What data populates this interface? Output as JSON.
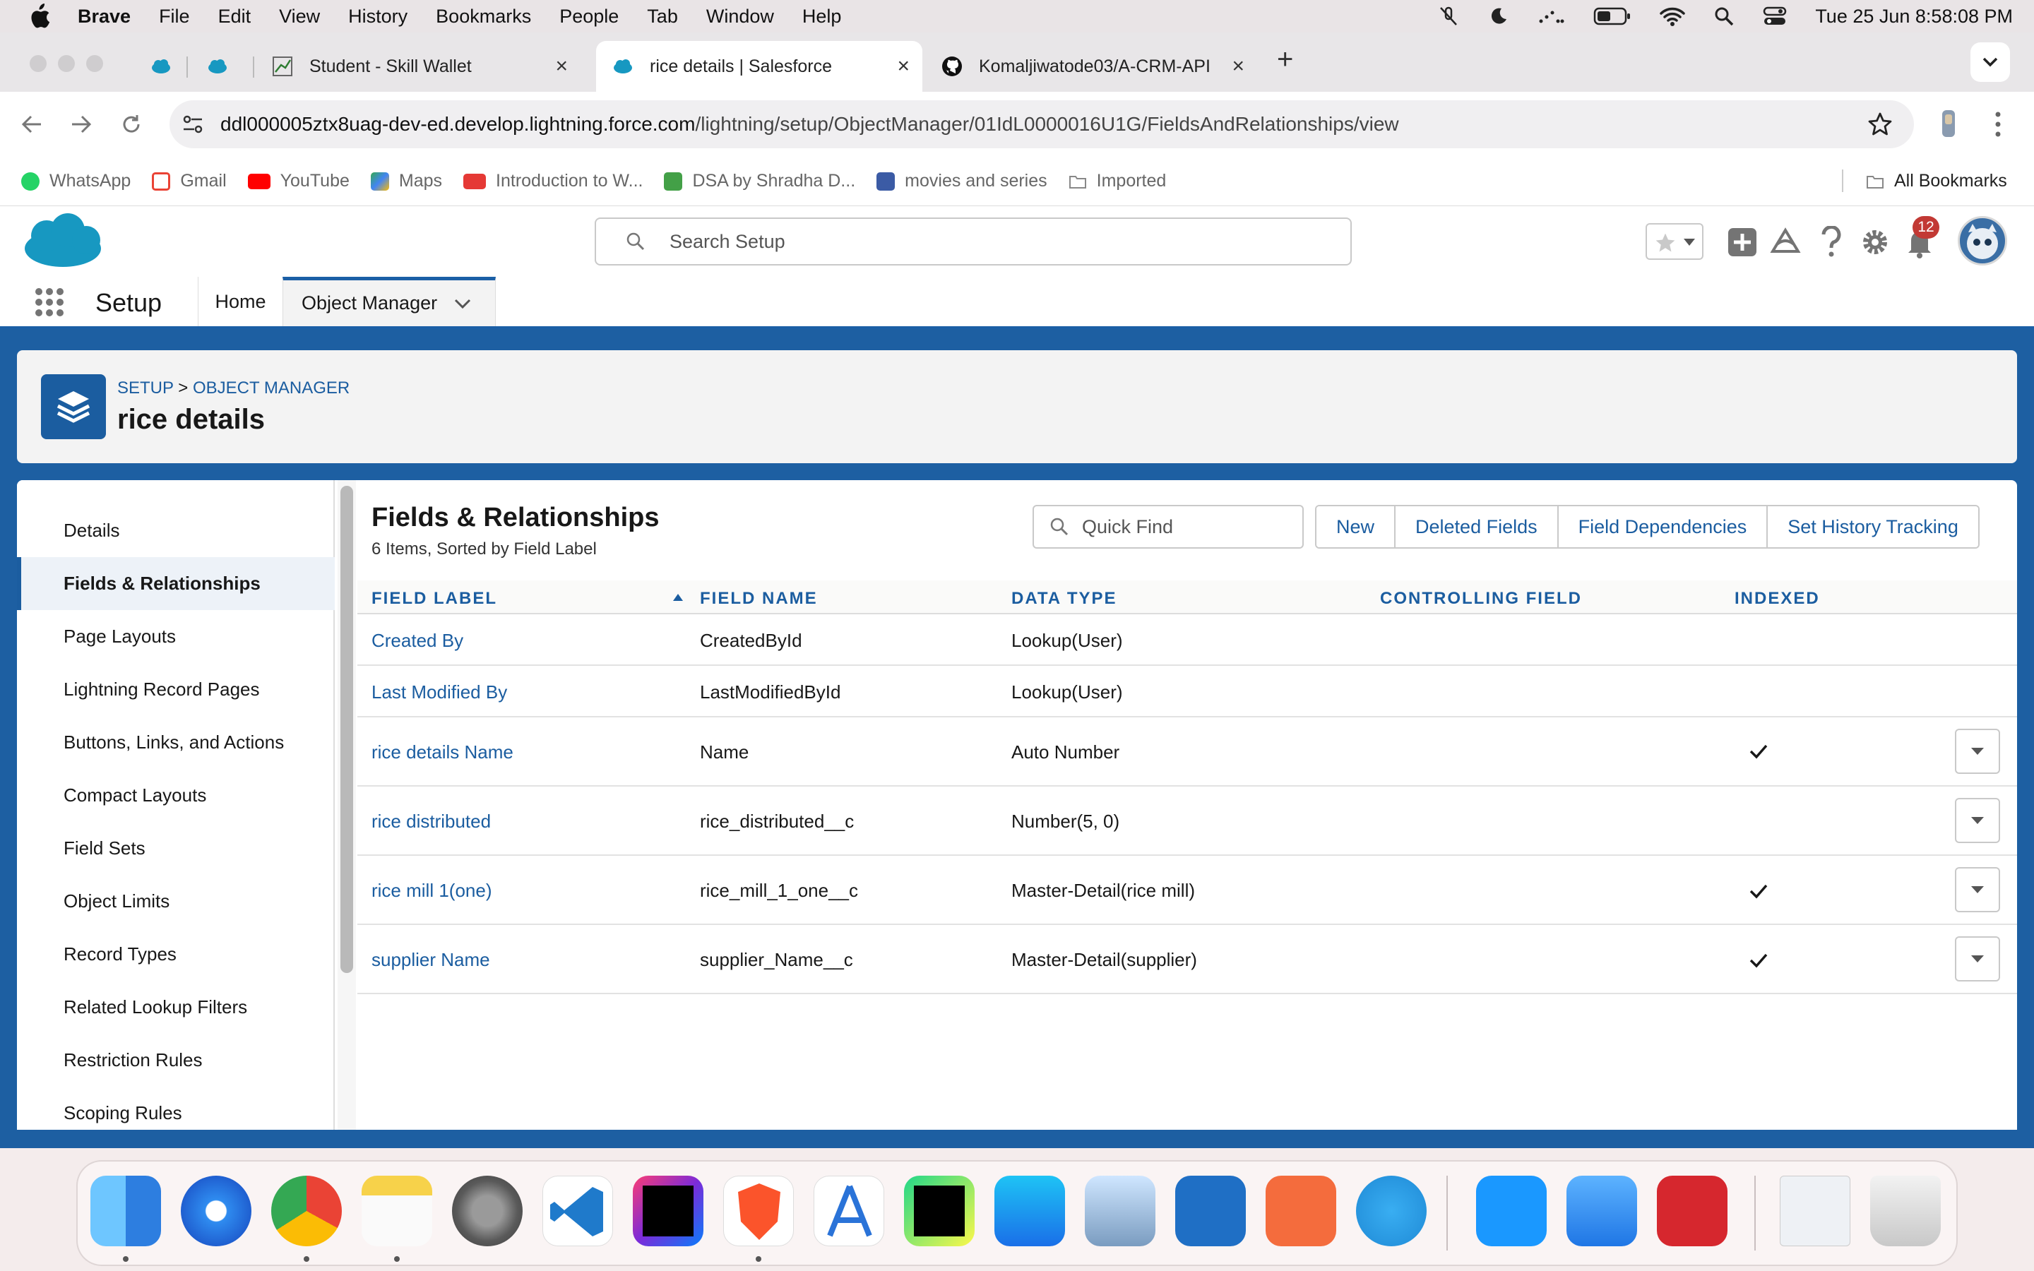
{
  "menubar": {
    "app": "Brave",
    "items": [
      "File",
      "Edit",
      "View",
      "History",
      "Bookmarks",
      "People",
      "Tab",
      "Window",
      "Help"
    ],
    "clock": "Tue 25 Jun  8:58:08 PM"
  },
  "tabs": [
    {
      "label": "Student - Skill Wallet"
    },
    {
      "label": "rice details | Salesforce"
    },
    {
      "label": "Komaljiwatode03/A-CRM-API"
    }
  ],
  "address": {
    "host": "ddl000005ztx8uag-dev-ed.develop.lightning.force.com",
    "path": "/lightning/setup/ObjectManager/01IdL0000016U1G/FieldsAndRelationships/view"
  },
  "bookmarks": {
    "items": [
      {
        "label": "WhatsApp",
        "color": "#25d366"
      },
      {
        "label": "Gmail",
        "color": "#ea4335"
      },
      {
        "label": "YouTube",
        "color": "#ff0000"
      },
      {
        "label": "Maps",
        "color": "#34a853"
      },
      {
        "label": "Introduction to W...",
        "color": "#e53935"
      },
      {
        "label": "DSA by Shradha D...",
        "color": "#43a047"
      },
      {
        "label": "movies and series",
        "color": "#3b5ba5"
      },
      {
        "label": "Imported",
        "color": "#999999"
      }
    ],
    "all": "All Bookmarks"
  },
  "sf": {
    "search_placeholder": "Search Setup",
    "notifications": "12",
    "nav": {
      "setup": "Setup",
      "home": "Home",
      "object_manager": "Object Manager"
    }
  },
  "object": {
    "crumb_setup": "SETUP",
    "crumb_sep": ">",
    "crumb_om": "OBJECT MANAGER",
    "title": "rice details"
  },
  "leftnav": [
    "Details",
    "Fields & Relationships",
    "Page Layouts",
    "Lightning Record Pages",
    "Buttons, Links, and Actions",
    "Compact Layouts",
    "Field Sets",
    "Object Limits",
    "Record Types",
    "Related Lookup Filters",
    "Restriction Rules",
    "Scoping Rules"
  ],
  "section": {
    "title": "Fields & Relationships",
    "subtitle": "6 Items, Sorted by Field Label",
    "quickfind_placeholder": "Quick Find",
    "buttons": [
      "New",
      "Deleted Fields",
      "Field Dependencies",
      "Set History Tracking"
    ]
  },
  "table": {
    "columns": [
      "FIELD LABEL",
      "FIELD NAME",
      "DATA TYPE",
      "CONTROLLING FIELD",
      "INDEXED"
    ],
    "rows": [
      {
        "label": "Created By",
        "name": "CreatedById",
        "type": "Lookup(User)",
        "controlling": "",
        "indexed": false
      },
      {
        "label": "Last Modified By",
        "name": "LastModifiedById",
        "type": "Lookup(User)",
        "controlling": "",
        "indexed": false
      },
      {
        "label": "rice details Name",
        "name": "Name",
        "type": "Auto Number",
        "controlling": "",
        "indexed": true
      },
      {
        "label": "rice distributed",
        "name": "rice_distributed__c",
        "type": "Number(5, 0)",
        "controlling": "",
        "indexed": false
      },
      {
        "label": "rice mill 1(one)",
        "name": "rice_mill_1_one__c",
        "type": "Master-Detail(rice mill)",
        "controlling": "",
        "indexed": true
      },
      {
        "label": "supplier Name",
        "name": "supplier_Name__c",
        "type": "Master-Detail(supplier)",
        "controlling": "",
        "indexed": true
      }
    ]
  },
  "colors": {
    "brand": "#1b5da0",
    "link": "#1b5da0",
    "nav_accent": "#1b5fa6"
  },
  "dock_apps": [
    "Finder",
    "Safari",
    "Chrome",
    "Notes",
    "System Settings",
    "VS Code",
    "IntelliJ IDEA",
    "Brave",
    "Android Studio",
    "PyCharm",
    "App Store",
    "Preview",
    "Trello",
    "Postman",
    "Telegram",
    "Prime Video",
    "Mail",
    "Photo Booth",
    "Downloads",
    "Trash"
  ]
}
